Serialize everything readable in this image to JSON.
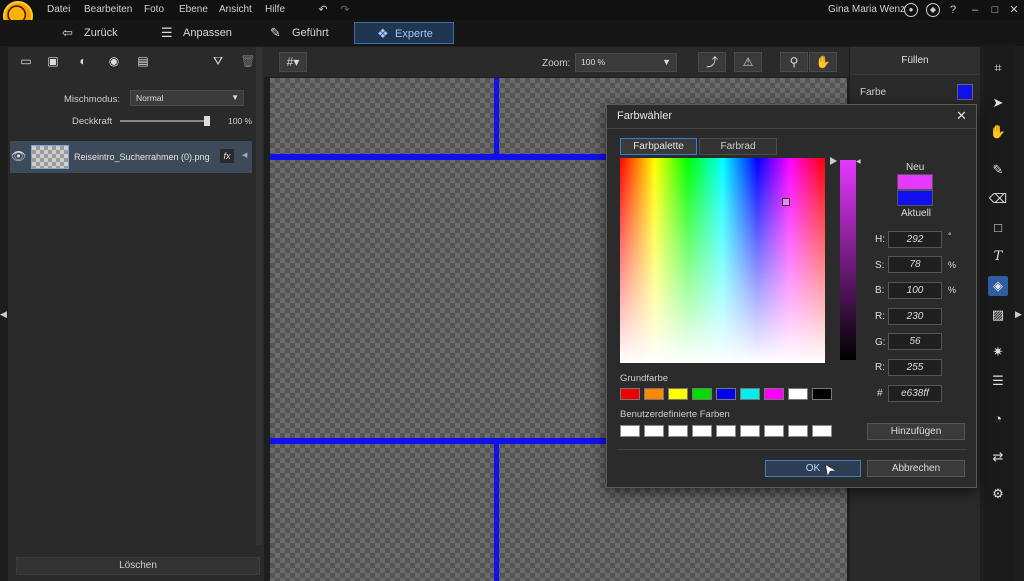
{
  "menu": [
    "Datei",
    "Bearbeiten",
    "Foto",
    "Ebene",
    "Ansicht",
    "Hilfe"
  ],
  "user": "Gina Maria Wenz",
  "modes": {
    "back": "Zurück",
    "adjust": "Anpassen",
    "guided": "Geführt",
    "expert": "Experte"
  },
  "layers_panel": {
    "blend_label": "Mischmodus:",
    "blend_value": "Normal",
    "opacity_label": "Deckkraft",
    "opacity_value": "100 %",
    "layer_name": "Reiseintro_Sucherrahmen (0).png",
    "fx": "fx",
    "delete": "Löschen"
  },
  "toolbar": {
    "zoom_label": "Zoom:",
    "zoom_value": "100 %"
  },
  "fill_panel": {
    "title": "Füllen",
    "color_label": "Farbe",
    "color": "#1111ee"
  },
  "dialog": {
    "title": "Farbwähler",
    "tab_palette": "Farbpalette",
    "tab_wheel": "Farbrad",
    "new_label": "Neu",
    "current_label": "Aktuell",
    "new_color": "#e638ff",
    "current_color": "#1111ee",
    "fields": {
      "h_label": "H:",
      "h": "292",
      "h_unit": "°",
      "s_label": "S:",
      "s": "78",
      "s_unit": "%",
      "b_label": "B:",
      "b": "100",
      "b_unit": "%",
      "r_label": "R:",
      "r": "230",
      "g_label": "G:",
      "g": "56",
      "bl_label": "R:",
      "bl": "255",
      "hex_label": "#",
      "hex": "e638ff"
    },
    "basic_label": "Grundfarbe",
    "basic_colors": [
      "#ee0000",
      "#ff8800",
      "#ffff00",
      "#00dd00",
      "#0000ee",
      "#00eeee",
      "#ff00ff",
      "#ffffff",
      "#000000"
    ],
    "custom_label": "Benutzerdefinierte Farben",
    "add": "Hinzufügen",
    "ok": "OK",
    "cancel": "Abbrechen"
  }
}
